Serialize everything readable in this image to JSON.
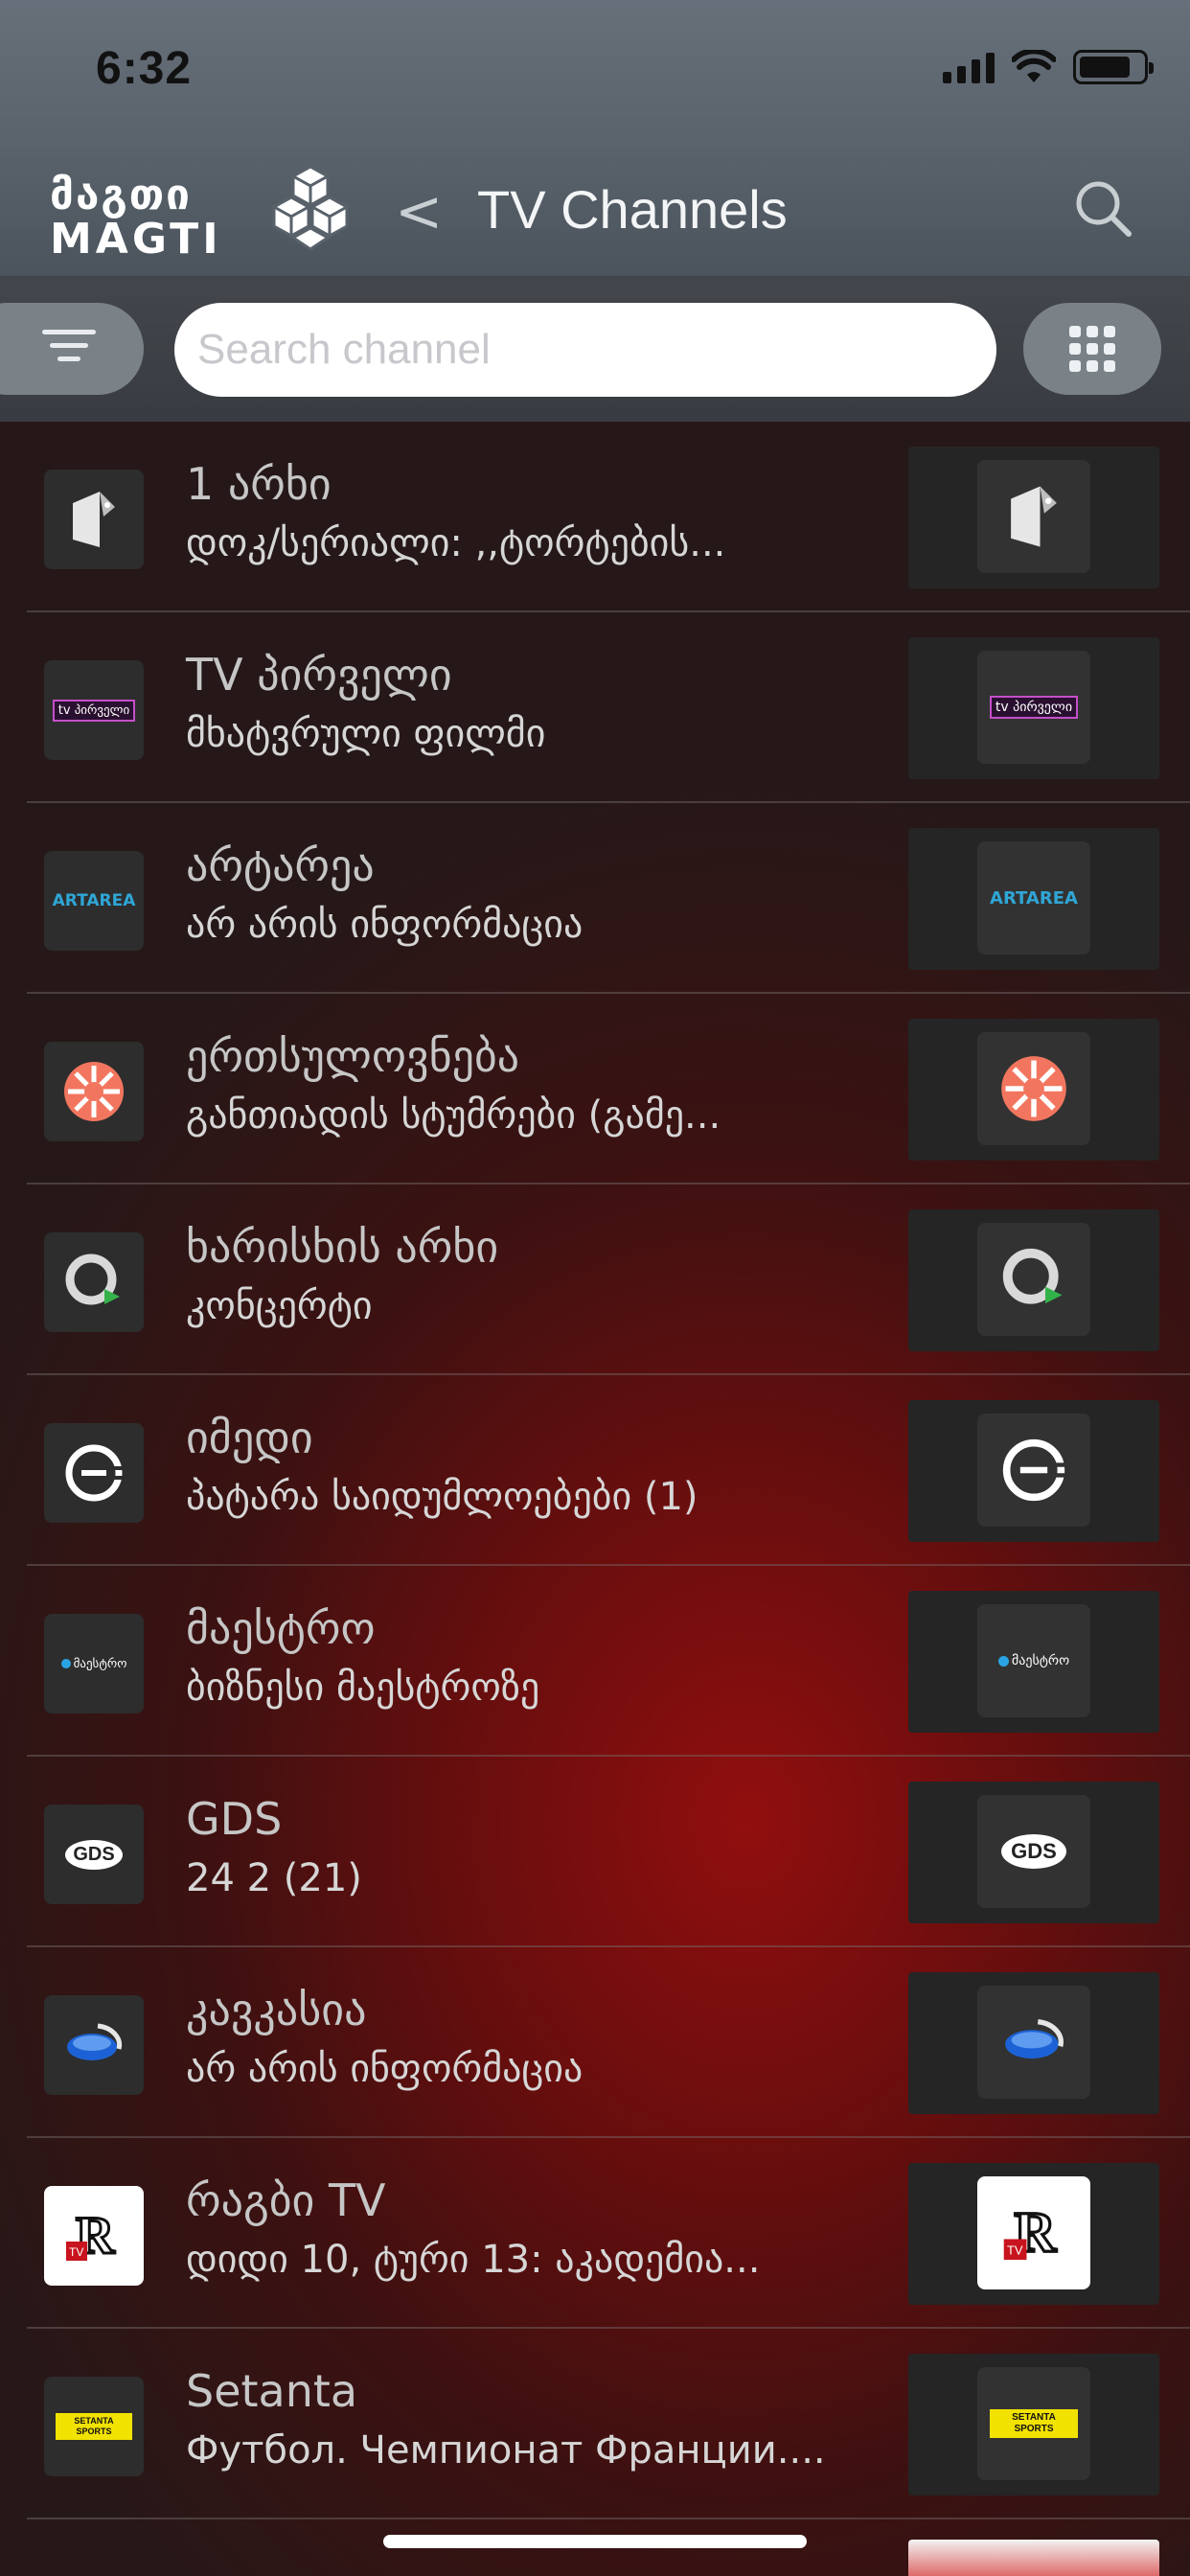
{
  "status_bar": {
    "time": "6:32"
  },
  "header": {
    "logo_georgian": "მაგთი",
    "logo_latin": "MAGTI",
    "back_symbol": "<",
    "title": "TV Channels"
  },
  "search": {
    "placeholder": "Search channel",
    "value": ""
  },
  "channels": [
    {
      "name": "1 არხი",
      "program": "დოკ/სერიალი: ,,ტორტების...",
      "logo_icon": "pervyi-kanal-logo-icon"
    },
    {
      "name": "TV პირველი",
      "program": "მხატვრული ფილმი",
      "logo_icon": "tv-pirveli-logo-icon",
      "logo_text": "tv პირველი"
    },
    {
      "name": "არტარეა",
      "program": "არ არის ინფორმაცია",
      "logo_icon": "artarea-logo-icon",
      "logo_text": "ARTAREA"
    },
    {
      "name": "ერთსულოვნება",
      "program": "განთიადის სტუმრები (გამე...",
      "logo_icon": "ertsulovneba-logo-icon"
    },
    {
      "name": "ხარისხის არხი",
      "program": "კონცერტი",
      "logo_icon": "khariskhis-arkhi-logo-icon"
    },
    {
      "name": "იმედი",
      "program": "პატარა საიდუმლოებები (1)",
      "logo_icon": "imedi-logo-icon"
    },
    {
      "name": "მაესტრო",
      "program": "ბიზნესი მაესტროზე",
      "logo_icon": "maestro-logo-icon",
      "logo_text": "მაესტრო"
    },
    {
      "name": "GDS",
      "program": "24 2 (21)",
      "logo_icon": "gds-logo-icon",
      "logo_text": "GDS"
    },
    {
      "name": "კავკასია",
      "program": "არ არის ინფორმაცია",
      "logo_icon": "kavkasia-logo-icon"
    },
    {
      "name": "რაგბი TV",
      "program": "დიდი 10, ტური 13: აკადემია...",
      "logo_icon": "rugby-tv-logo-icon",
      "logo_text": "TV"
    },
    {
      "name": "Setanta",
      "program": "Футбол. Чемпионат Франции....",
      "logo_icon": "setanta-sports-logo-icon",
      "logo_text": "SETANTA SPORTS"
    }
  ],
  "colors": {
    "header_bg": "#5e6770",
    "accent_red": "#8e1010",
    "text_primary": "#c6c6c6",
    "text_secondary": "#d6d6d6"
  }
}
